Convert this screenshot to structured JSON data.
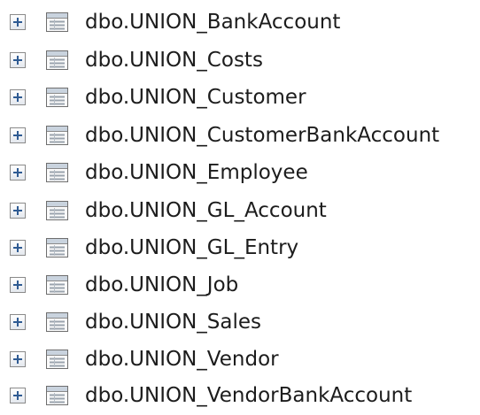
{
  "object_explorer": {
    "tables": [
      {
        "label": "dbo.UNION_BankAccount",
        "icon": "table-icon",
        "expander": "plus-icon"
      },
      {
        "label": "dbo.UNION_Costs",
        "icon": "table-icon",
        "expander": "plus-icon"
      },
      {
        "label": "dbo.UNION_Customer",
        "icon": "table-icon",
        "expander": "plus-icon"
      },
      {
        "label": "dbo.UNION_CustomerBankAccount",
        "icon": "table-icon",
        "expander": "plus-icon"
      },
      {
        "label": "dbo.UNION_Employee",
        "icon": "table-icon",
        "expander": "plus-icon"
      },
      {
        "label": "dbo.UNION_GL_Account",
        "icon": "table-icon",
        "expander": "plus-icon"
      },
      {
        "label": "dbo.UNION_GL_Entry",
        "icon": "table-icon",
        "expander": "plus-icon"
      },
      {
        "label": "dbo.UNION_Job",
        "icon": "table-icon",
        "expander": "plus-icon"
      },
      {
        "label": "dbo.UNION_Sales",
        "icon": "table-icon",
        "expander": "plus-icon"
      },
      {
        "label": "dbo.UNION_Vendor",
        "icon": "table-icon",
        "expander": "plus-icon"
      },
      {
        "label": "dbo.UNION_VendorBankAccount",
        "icon": "table-icon",
        "expander": "plus-icon"
      }
    ]
  },
  "colors": {
    "text": "#1c1c1c",
    "expander_sign": "#2f5b93",
    "icon_border": "#6e6e6e",
    "icon_header": "#c9d3de"
  }
}
